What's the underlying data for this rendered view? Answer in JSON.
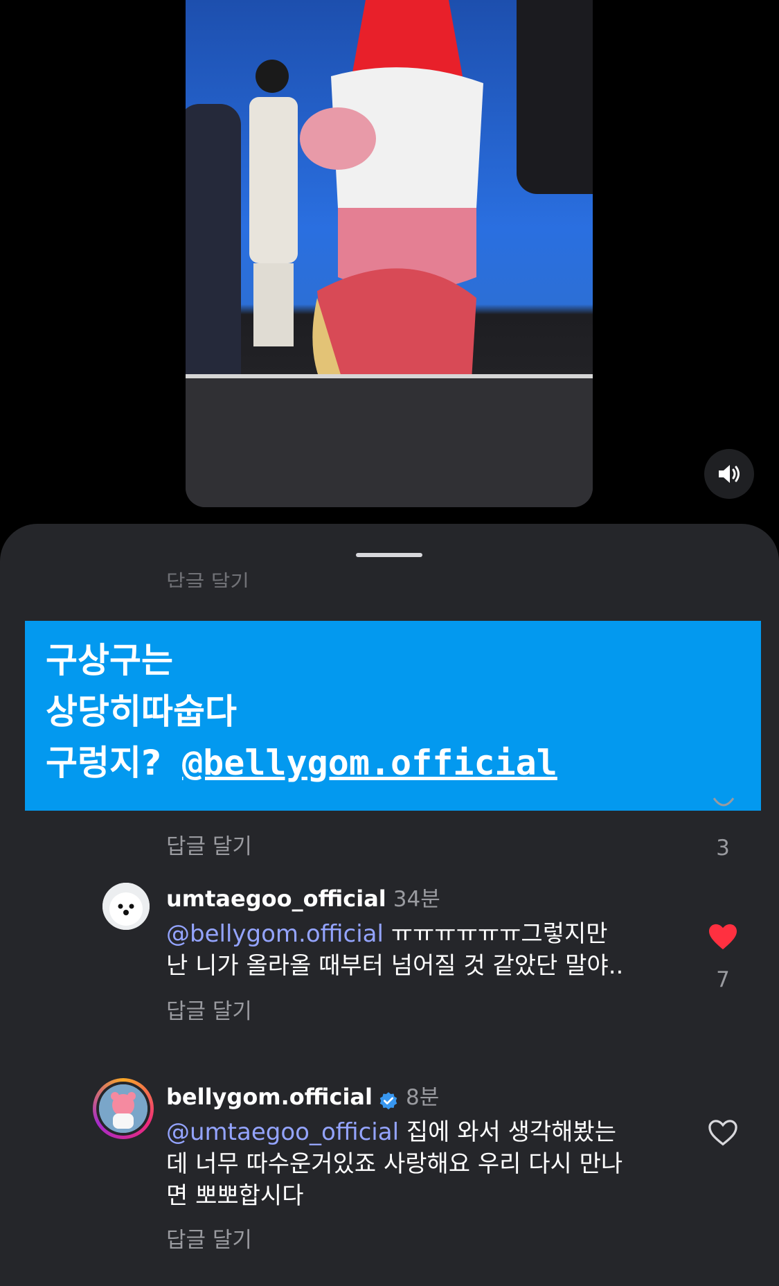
{
  "overlay_text": {
    "line1": "구상구는",
    "line2": "상당히따숩다",
    "line3_prefix": "구렁지?",
    "line3_mention": "@bellygom.official"
  },
  "sheet": {
    "faded_reply_label": "답글 달기"
  },
  "comments": [
    {
      "reply_label": "답글 달기",
      "like_count": "3",
      "liked": false
    },
    {
      "username": "umtaegoo_official",
      "time": "34분",
      "mention": "@bellygom.official",
      "text_line1_rest": " ㅠㅠㅠㅠㅠㅠ그렇지만",
      "text_line2": "난 니가 올라올 때부터 넘어질 것 같았단 말야..",
      "reply_label": "답글 달기",
      "like_count": "7",
      "liked": true
    },
    {
      "username": "bellygom.official",
      "verified": true,
      "time": "8분",
      "mention": "@umtaegoo_official",
      "text_line1_rest": " 집에 와서 생각해봤는",
      "text_line2": "데 너무 따수운거있죠 사랑해요 우리 다시 만나",
      "text_line3": "면 뽀뽀합시다",
      "reply_label": "답글 달기",
      "liked": false
    }
  ],
  "colors": {
    "sheet_bg": "#25262a",
    "overlay_bg": "#0399ef",
    "mention": "#94a4ff",
    "like_red": "#ff3040",
    "muted": "#9a9ba0"
  },
  "icons": [
    "speaker-icon",
    "heart-filled-icon",
    "heart-outline-icon",
    "verified-badge-icon"
  ]
}
